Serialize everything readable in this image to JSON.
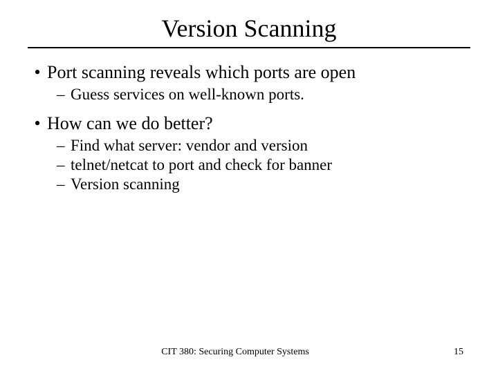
{
  "title": "Version Scanning",
  "bullets": {
    "b1": {
      "text": "Port scanning reveals which ports are open",
      "subs": {
        "s1": "Guess services on well-known ports."
      }
    },
    "b2": {
      "text": "How can we do better?",
      "subs": {
        "s1": "Find what server: vendor and version",
        "s2": "telnet/netcat to port and check for banner",
        "s3": "Version scanning"
      }
    }
  },
  "footer": {
    "course": "CIT 380: Securing Computer Systems",
    "page": "15"
  }
}
